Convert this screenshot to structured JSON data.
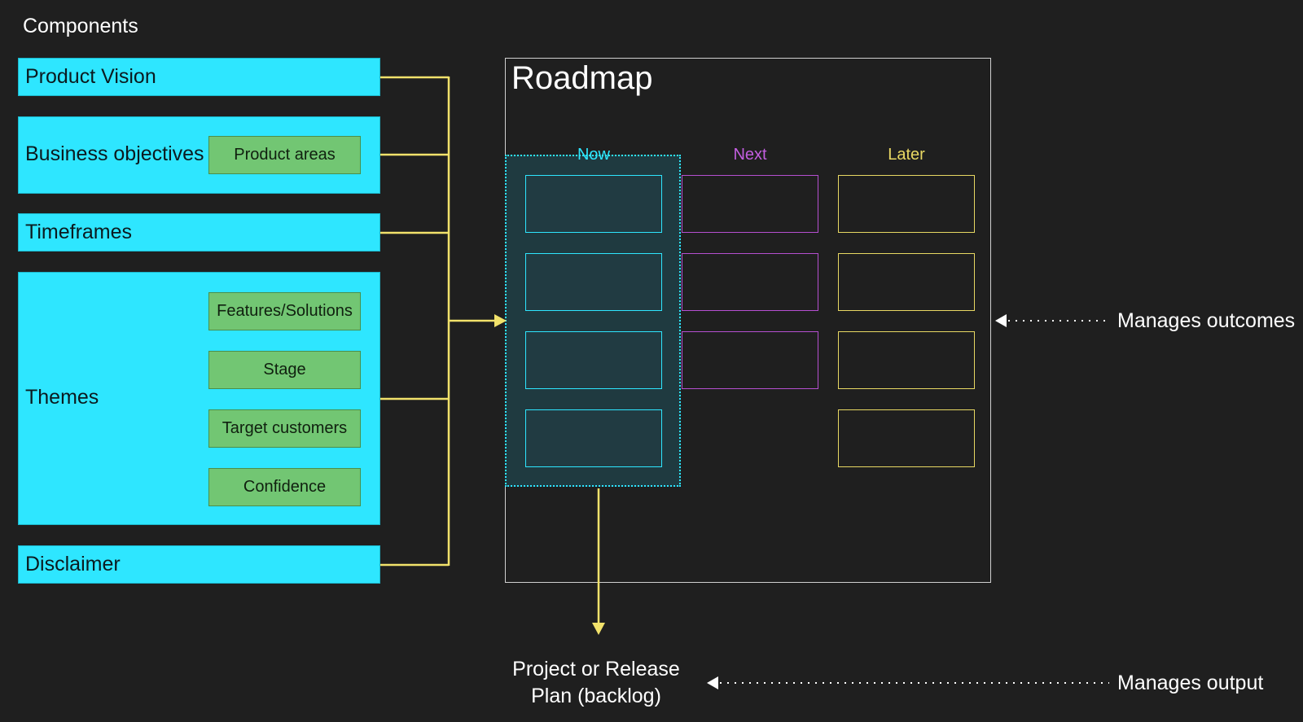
{
  "heading": "Components",
  "components": {
    "product_vision": "Product Vision",
    "business_objectives": "Business objectives",
    "product_areas": "Product areas",
    "timeframes": "Timeframes",
    "themes": "Themes",
    "features_solutions": "Features/Solutions",
    "stage": "Stage",
    "target_customers": "Target customers",
    "confidence": "Confidence",
    "disclaimer": "Disclaimer"
  },
  "roadmap": {
    "title": "Roadmap",
    "columns": [
      {
        "label": "Now",
        "color": "#2ee6ff",
        "cards": 4
      },
      {
        "label": "Next",
        "color": "#b54fd0",
        "cards": 3
      },
      {
        "label": "Later",
        "color": "#e8d863",
        "cards": 4
      }
    ]
  },
  "annotations": {
    "manages_outcomes": "Manages outcomes",
    "manages_output": "Manages output",
    "plan_line1": "Project or Release",
    "plan_line2": "Plan (backlog)"
  },
  "colors": {
    "background": "#1f1f1f",
    "component_fill": "#2ee6ff",
    "subcomponent_fill": "#72c673",
    "connector": "#f2e26b"
  }
}
